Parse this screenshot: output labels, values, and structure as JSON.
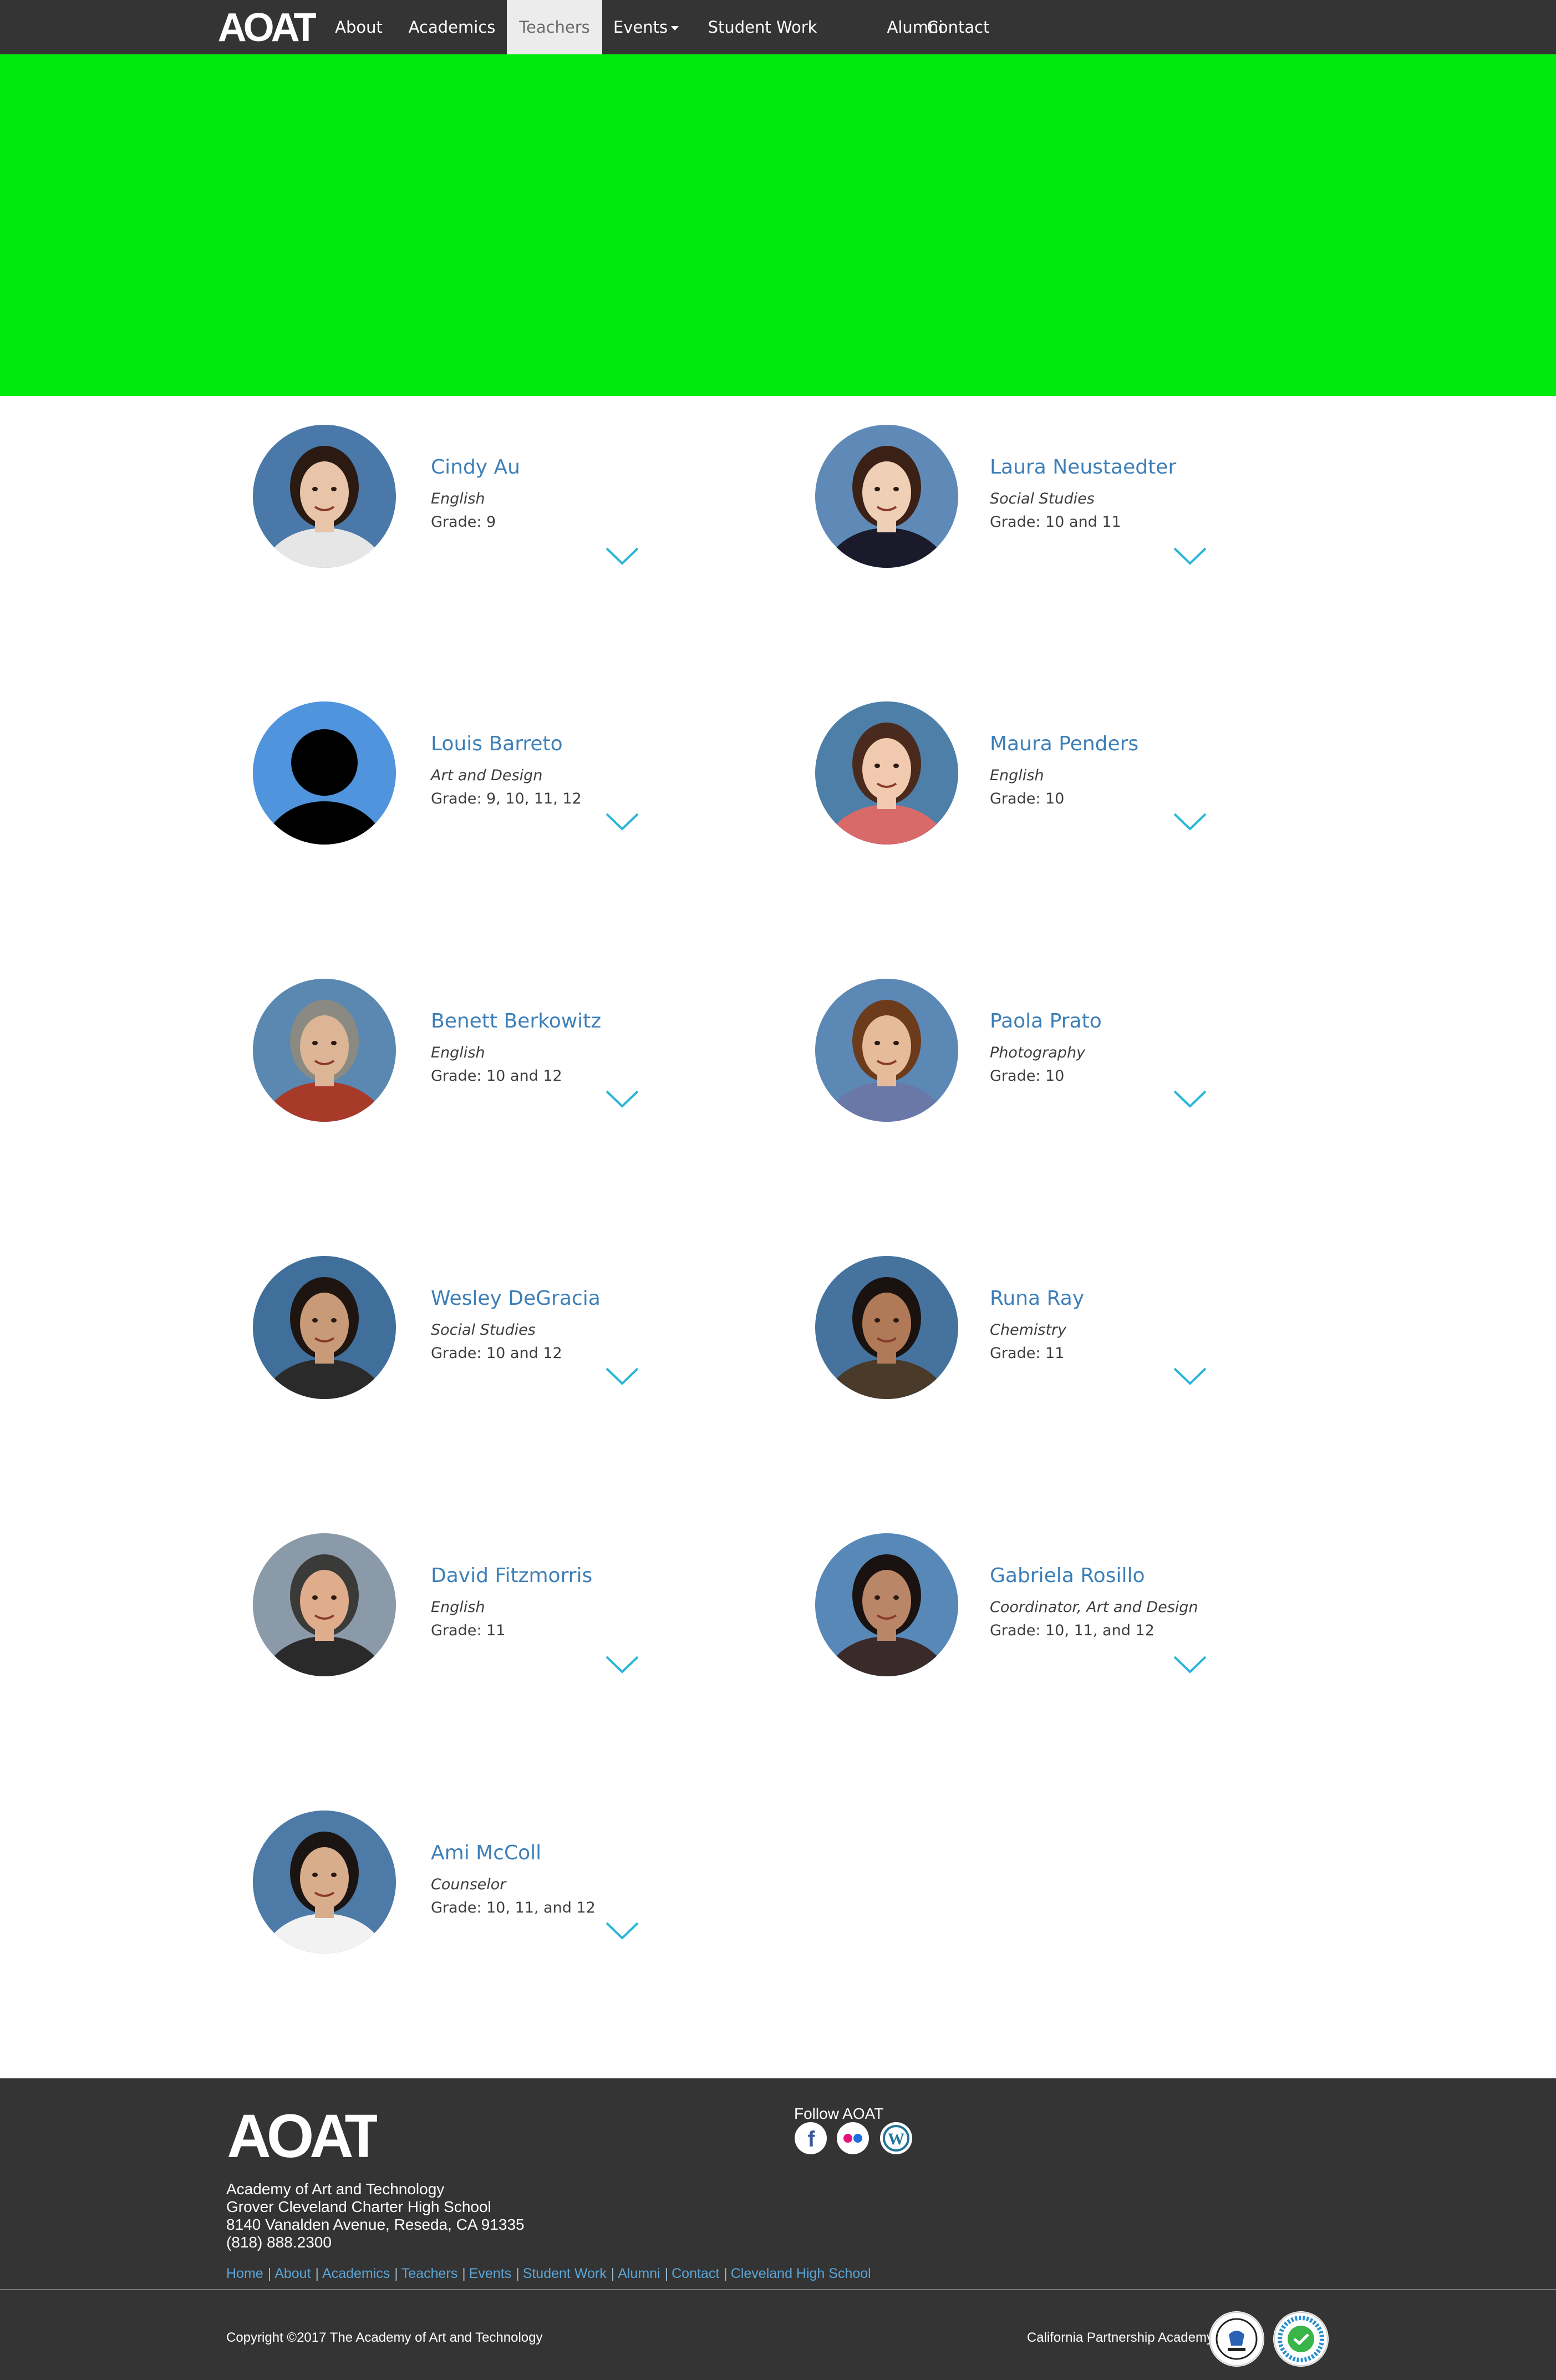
{
  "nav": {
    "logo_text": "AOAT",
    "items": [
      {
        "label": "About"
      },
      {
        "label": "Academics"
      },
      {
        "label": "Teachers"
      },
      {
        "label": "Events"
      },
      {
        "label": "Student Work"
      },
      {
        "label": "Alumni"
      },
      {
        "label": "Contact"
      }
    ]
  },
  "colors": {
    "navbar": "#343434",
    "hero": "#00ea0d",
    "teacher_name": "#3d7fb8",
    "chevron": "#29b6d8",
    "footer_link": "#5aa6d8"
  },
  "teachers": [
    {
      "name": "Cindy Au",
      "subject": "English",
      "grade": "Grade: 9"
    },
    {
      "name": "Laura Neustaedter",
      "subject": "Social Studies",
      "grade": "Grade: 10 and 11"
    },
    {
      "name": "Louis Barreto",
      "subject": "Art and Design",
      "grade": "Grade: 9, 10, 11, 12"
    },
    {
      "name": "Maura Penders",
      "subject": "English",
      "grade": "Grade: 10"
    },
    {
      "name": "Benett Berkowitz",
      "subject": "English",
      "grade": "Grade: 10 and 12"
    },
    {
      "name": "Paola Prato",
      "subject": "Photography",
      "grade": "Grade: 10"
    },
    {
      "name": "Wesley DeGracia",
      "subject": "Social Studies",
      "grade": "Grade: 10 and 12"
    },
    {
      "name": "Runa Ray",
      "subject": "Chemistry",
      "grade": "Grade: 11"
    },
    {
      "name": "David Fitzmorris",
      "subject": "English",
      "grade": "Grade: 11"
    },
    {
      "name": "Gabriela Rosillo",
      "subject": "Coordinator, Art and Design",
      "grade": "Grade: 10, 11, and 12"
    },
    {
      "name": "Ami McColl",
      "subject": "Counselor",
      "grade": "Grade: 10, 11, and 12"
    }
  ],
  "footer": {
    "logo_text": "AOAT",
    "address": [
      "Academy of Art and Technology",
      "Grover Cleveland Charter High School",
      "8140 Vanalden Avenue, Reseda, CA 91335",
      "(818) 888.2300"
    ],
    "follow_label": "Follow AOAT",
    "social": [
      {
        "icon": "facebook-icon",
        "glyph": "f"
      },
      {
        "icon": "flickr-icon",
        "glyph": ""
      },
      {
        "icon": "wordpress-icon",
        "glyph": "W"
      }
    ],
    "links": [
      "Home",
      "About",
      "Academics",
      "Teachers",
      "Events",
      "Student Work",
      "Alumni",
      "Contact",
      "Cleveland High School"
    ],
    "link_separator": "|",
    "copyright": "Copyright ©2017 The Academy of Art and Technology",
    "partnership_label": "California Partnership Academy"
  }
}
